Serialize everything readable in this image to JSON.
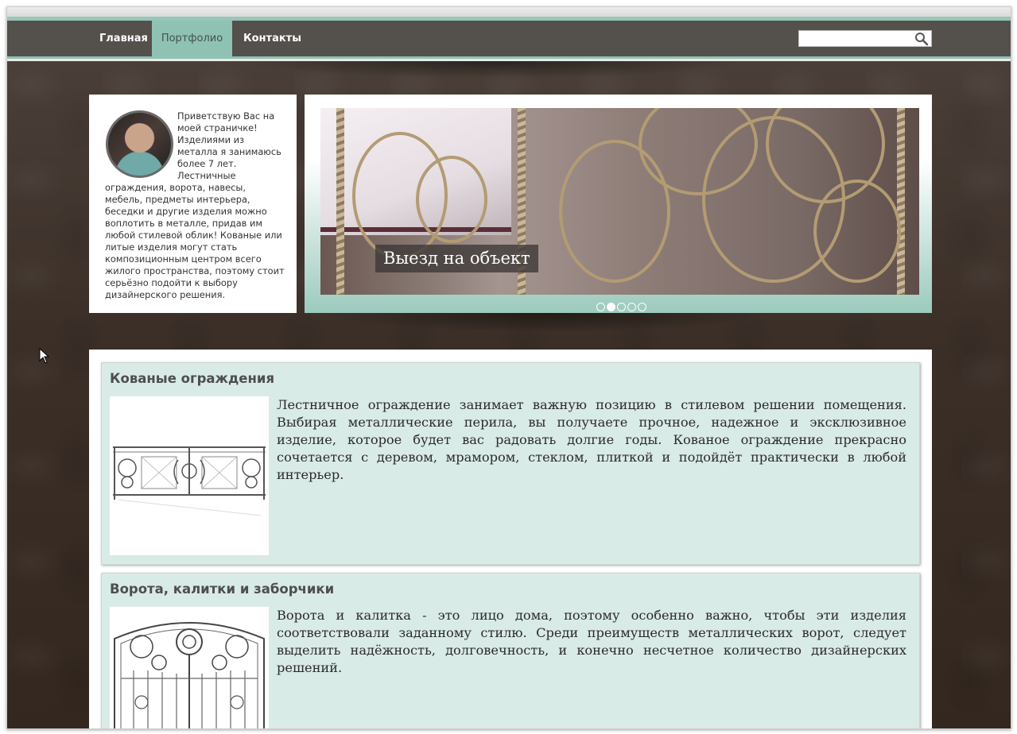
{
  "nav": {
    "items": [
      {
        "label": "Главная",
        "active": false
      },
      {
        "label": "Портфолио",
        "active": true
      },
      {
        "label": "Контакты",
        "active": false
      }
    ],
    "search": {
      "value": "",
      "icon": "search-icon"
    }
  },
  "intro": {
    "text": "Приветствую Вас на моей страничке! Изделиями из металла я занимаюсь более 7 лет. Лестничные ограждения, ворота, навесы, мебель, предметы интерьера, беседки и другие изделия можно воплотить в металле, придав им любой стилевой облик! Кованые или литые изделия могут стать композиционным центром всего жилого пространства, поэтому стоит серьёзно подойти к выбору дизайнерского решения."
  },
  "slider": {
    "caption": "Выезд на объект",
    "slide_count": 5,
    "active_slide": 2
  },
  "cards": [
    {
      "title": "Кованые ограждения",
      "text": "Лестничное ограждение занимает важную позицию в стилевом решении помещения. Выбирая металлические перила, вы получаете прочное, надежное и эксклюзивное изделие, которое будет вас радовать долгие годы. Кованое ограждение прекрасно сочетается с деревом, мрамором, стеклом, плиткой и подойдёт практически в любой интерьер."
    },
    {
      "title": "Ворота, калитки и заборчики",
      "text": "Ворота и калитка - это лицо дома, поэтому особенно важно, чтобы эти изделия соответствовали заданному стилю. Среди преимуществ металлических ворот, следует выделить надёжность, долговечность, и конечно несчетное количество дизайнерских решений."
    }
  ],
  "colors": {
    "nav_bg": "#54504b",
    "accent": "#8fc2b2",
    "card_bg": "#d9ebe6",
    "page_bg": "#3d3029"
  }
}
